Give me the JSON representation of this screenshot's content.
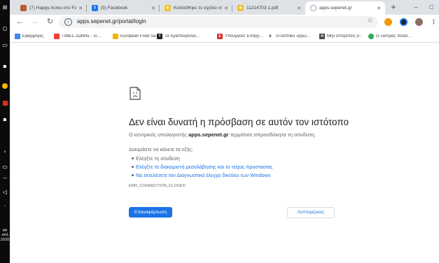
{
  "taskbar": {
    "clock": [
      "μμ",
      "σκή",
      "2020"
    ]
  },
  "tabs": [
    {
      "title": "(7) Happy Acres στο Face",
      "color": "#b4602c",
      "glyph": "f"
    },
    {
      "title": "(5) Facebook",
      "color": "#1877f2",
      "glyph": "f"
    },
    {
      "title": "Κατατέθηκε το σχέδιο νό",
      "color": "#e0a800",
      "glyph": "★"
    },
    {
      "title": "11214703-1.pdf",
      "color": "#e0a800",
      "glyph": "★"
    },
    {
      "title": "apps.sepenet.gr",
      "color": "#9aa0a6",
      "glyph": ""
    }
  ],
  "toolbar": {
    "url": "apps.sepenet.gr/portal/login"
  },
  "bookmarks": [
    {
      "label": "Εφαρμογές",
      "color": "#4285f4",
      "glyph": "⠿"
    },
    {
      "label": "ΤΙΜΕΣ ΖΩΝΗΣ - G...",
      "color": "#ea4335",
      "glyph": "T"
    },
    {
      "label": "European Food Sa...",
      "color": "#f4b400",
      "glyph": "e"
    },
    {
      "label": "Τα Χριστούγεννα...",
      "color": "#202124",
      "glyph": "T"
    },
    {
      "label": "Υπουργείο: Επαγγ...",
      "color": "#d93025",
      "glyph": "E"
    },
    {
      "label": "Το κοπτικό «βρώ...",
      "color": "#202124",
      "glyph": "b"
    },
    {
      "label": "Μην επιτρέπεις σ...",
      "color": "#444444",
      "glyph": "N"
    },
    {
      "label": "Ο «άντρας πολιά...",
      "color": "#34a853",
      "glyph": "Ο"
    }
  ],
  "error": {
    "title": "Δεν είναι δυνατή η πρόσβαση σε αυτόν τον ιστότοπο",
    "desc_prefix": "Ο κεντρικός υπολογιστής",
    "host": "apps.sepenet.gr",
    "desc_suffix": "τερμάτισε απροσδόκητα τη σύνδεση.",
    "try_label": "Δοκιμάστε να κάνετε τα εξής:",
    "suggestions": [
      "Ελέγξτε τη σύνδεση",
      "Ελέγξτε το διακομιστή μεσολάβησης και το τείχος προστασίας",
      "Να εκτελέσετε τον Διαγνωστικό έλεγχο δικτύου των Windows"
    ],
    "code": "ERR_CONNECTION_CLOSED",
    "reload_label": "Επαναφόρτωση",
    "details_label": "Λεπτομέρειες"
  }
}
